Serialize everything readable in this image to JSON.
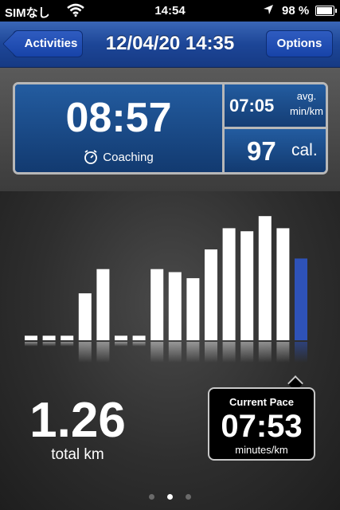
{
  "status_bar": {
    "carrier": "SIMなし",
    "time": "14:54",
    "battery": "98 %",
    "icons": [
      "wifi-icon",
      "location-arrow-icon",
      "battery-icon"
    ]
  },
  "nav": {
    "back_label": "Activities",
    "title": "12/04/20 14:35",
    "options_label": "Options"
  },
  "summary": {
    "duration": "08:57",
    "coaching_label": "Coaching",
    "coaching_icon": "stopwatch-icon",
    "avg_pace": "07:05",
    "avg_pace_unit_line1": "avg.",
    "avg_pace_unit_line2": "min/km",
    "calories": "97",
    "calories_unit": "cal."
  },
  "distance": {
    "value": "1.26",
    "label": "total km"
  },
  "current_pace": {
    "title": "Current Pace",
    "value": "07:53",
    "unit": "minutes/km"
  },
  "pager": {
    "pages": 3,
    "active_index": 1
  },
  "colors": {
    "nav_blue": "#1d4697",
    "panel_blue": "#17467f",
    "bar_white": "#ffffff",
    "bar_current": "#2e52b8"
  },
  "chart_data": {
    "type": "bar",
    "values": [
      0.03,
      0.03,
      0.03,
      0.31,
      0.47,
      0.03,
      0.03,
      0.47,
      0.45,
      0.41,
      0.6,
      0.74,
      0.72,
      0.82,
      0.74,
      0.54
    ],
    "highlight_index": 15,
    "note_scale": "relative pace per segment (0-1)"
  }
}
